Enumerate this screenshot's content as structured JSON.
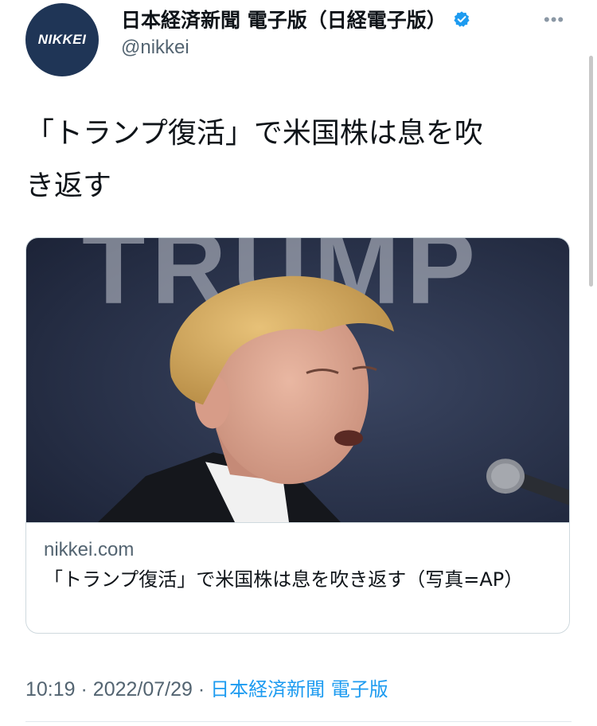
{
  "tweet": {
    "author": {
      "display_name": "日本経済新聞 電子版（日経電子版）",
      "handle": "@nikkei",
      "avatar_text": "NIKKEI",
      "verified": true
    },
    "more_label": "•••",
    "text_lines": [
      "「トランプ復活」で米国株は息を吹",
      "き返す"
    ],
    "card": {
      "image_text": "TRUMP",
      "domain": "nikkei.com",
      "title": "「トランプ復活」で米国株は息を吹き返す（写真=AP）"
    },
    "meta": {
      "time": "10:19",
      "separator": "·",
      "date": "2022/07/29",
      "source": "日本経済新聞 電子版"
    }
  },
  "colors": {
    "link": "#1d9bf0",
    "secondary_text": "#536471",
    "avatar_bg": "#1f3556"
  }
}
